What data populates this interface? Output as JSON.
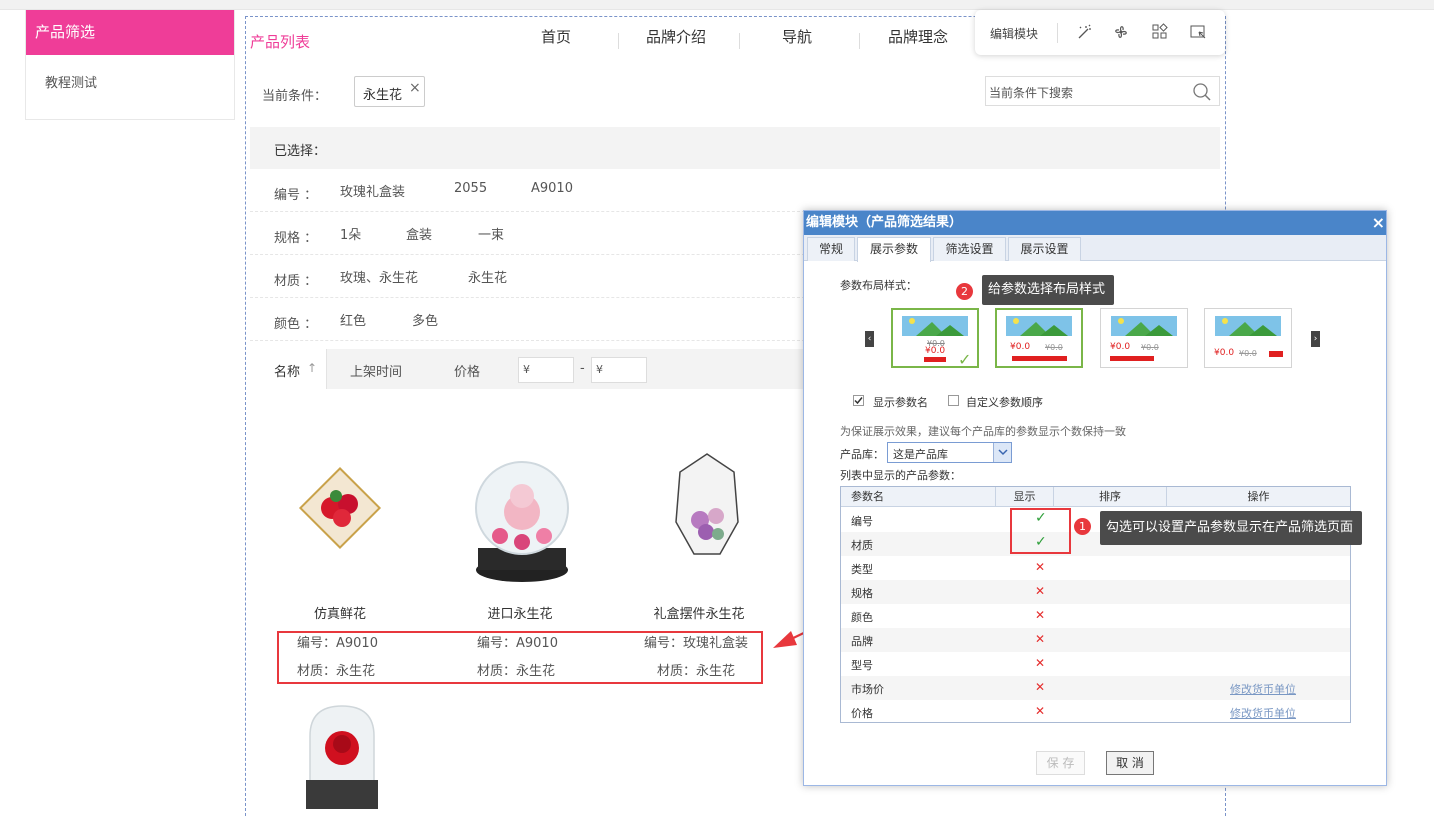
{
  "left_panel": {
    "title": "产品筛选",
    "item": "教程测试"
  },
  "module": {
    "title": "产品列表",
    "nav": [
      "首页",
      "品牌介绍",
      "导航",
      "品牌理念"
    ],
    "toolbar_label": "编辑模块"
  },
  "condition": {
    "label": "当前条件：",
    "tag": "永生花",
    "tag_close": "×",
    "search_placeholder": "当前条件下搜索"
  },
  "selected": {
    "label": "已选择："
  },
  "filters": [
    {
      "label": "编号 ：",
      "values": [
        "玫瑰礼盒装",
        "2055",
        "A9010"
      ]
    },
    {
      "label": "规格 ：",
      "values": [
        "1朵",
        "盒装",
        "一束"
      ]
    },
    {
      "label": "材质 ：",
      "values": [
        "玫瑰、永生花",
        "永生花"
      ]
    },
    {
      "label": "颜色 ：",
      "values": [
        "红色",
        "多色"
      ]
    }
  ],
  "sort": {
    "name": "名称",
    "name_arrow": "↑",
    "time": "上架时间",
    "price": "价格",
    "price_min": "¥",
    "price_max": "¥",
    "dash": "-"
  },
  "products": [
    {
      "name": "仿真鲜花",
      "code": "编号：A9010",
      "material": "材质：永生花"
    },
    {
      "name": "进口永生花",
      "code": "编号：A9010",
      "material": "材质：永生花"
    },
    {
      "name": "礼盒摆件永生花",
      "code": "编号：玫瑰礼盒装",
      "material": "材质：永生花"
    }
  ],
  "dialog": {
    "title": "编辑模块（产品筛选结果）",
    "close": "×",
    "tabs": [
      "常规",
      "展示参数",
      "筛选设置",
      "展示设置"
    ],
    "active_tab": "展示参数",
    "layout_label": "参数布局样式：",
    "tooltip2": {
      "badge": "2",
      "text": "给参数选择布局样式"
    },
    "cards": [
      {
        "old_price": "¥0.0",
        "price": "¥0.0",
        "price_inline": ""
      },
      {
        "old_price": "",
        "price": "¥0.0",
        "price_inline": "¥0.0"
      },
      {
        "old_price": "",
        "price": "¥0.0",
        "price_inline": "¥0.0"
      },
      {
        "old_price": "",
        "price": "¥0.0",
        "price_inline": "¥0.0"
      }
    ],
    "show_param_name": "显示参数名",
    "custom_order": "自定义参数顺序",
    "note": "为保证展示效果，建议每个产品库的参数显示个数保持一致",
    "lib_label": "产品库：",
    "lib_value": "这是产品库",
    "list_label": "列表中显示的产品参数：",
    "columns": [
      "参数名",
      "显示",
      "排序",
      "操作"
    ],
    "params": [
      {
        "name": "编号",
        "show": true,
        "op": ""
      },
      {
        "name": "材质",
        "show": true,
        "op": ""
      },
      {
        "name": "类型",
        "show": false,
        "op": ""
      },
      {
        "name": "规格",
        "show": false,
        "op": ""
      },
      {
        "name": "颜色",
        "show": false,
        "op": ""
      },
      {
        "name": "品牌",
        "show": false,
        "op": ""
      },
      {
        "name": "型号",
        "show": false,
        "op": ""
      },
      {
        "name": "市场价",
        "show": false,
        "op": "修改货币单位"
      },
      {
        "name": "价格",
        "show": false,
        "op": "修改货币单位"
      }
    ],
    "tooltip1": {
      "badge": "1",
      "text": "勾选可以设置产品参数显示在产品筛选页面"
    },
    "save": "保 存",
    "cancel": "取 消"
  },
  "colors": {
    "accent": "#ef3d98",
    "dialog_header": "#4a85c9",
    "highlight": "#e8383d",
    "ok": "#2e9f3a"
  }
}
